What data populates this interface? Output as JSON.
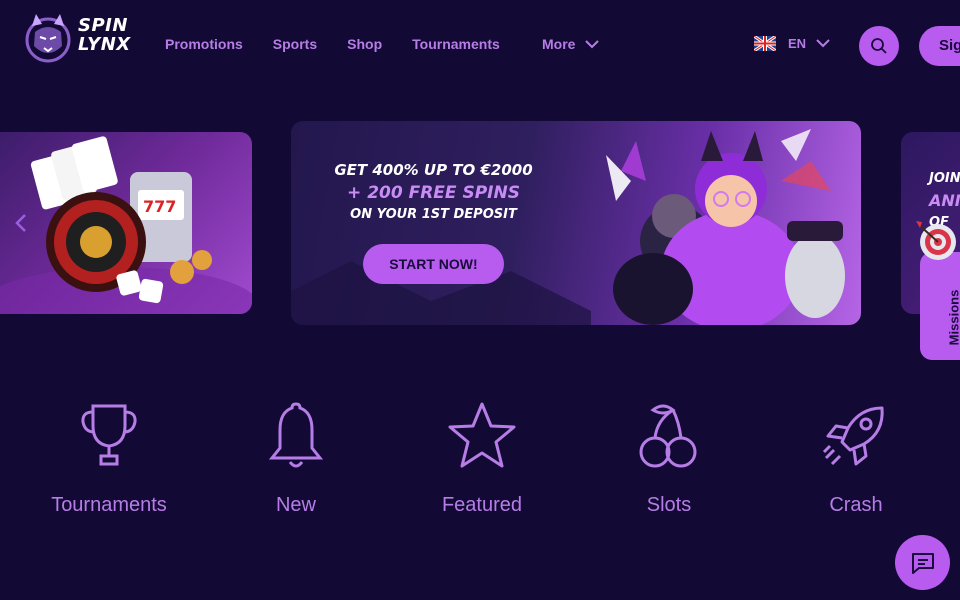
{
  "brand": {
    "line1": "SPIN",
    "line2": "LYNX"
  },
  "nav": {
    "items": [
      {
        "label": "Promotions"
      },
      {
        "label": "Sports"
      },
      {
        "label": "Shop"
      },
      {
        "label": "Tournaments"
      }
    ],
    "more_label": "More"
  },
  "language": {
    "code": "EN",
    "flag": "uk-flag-icon"
  },
  "header": {
    "signup_label": "Sig"
  },
  "promo": {
    "line1": "GET 400% UP TO €2000",
    "line2": "+ 200 FREE SPINS",
    "line3": "ON YOUR 1ST DEPOSIT",
    "cta": "START NOW!"
  },
  "side_banner": {
    "line1": "JOIN",
    "line2": "ANI",
    "line3": "OF"
  },
  "missions": {
    "label": "Missions"
  },
  "categories": [
    {
      "label": "Tournaments",
      "icon": "trophy-icon"
    },
    {
      "label": "New",
      "icon": "bell-icon"
    },
    {
      "label": "Featured",
      "icon": "star-icon"
    },
    {
      "label": "Slots",
      "icon": "cherries-icon"
    },
    {
      "label": "Crash",
      "icon": "rocket-icon"
    }
  ],
  "colors": {
    "background": "#120a35",
    "accent": "#b85cf0",
    "nav_text": "#b77de6"
  }
}
